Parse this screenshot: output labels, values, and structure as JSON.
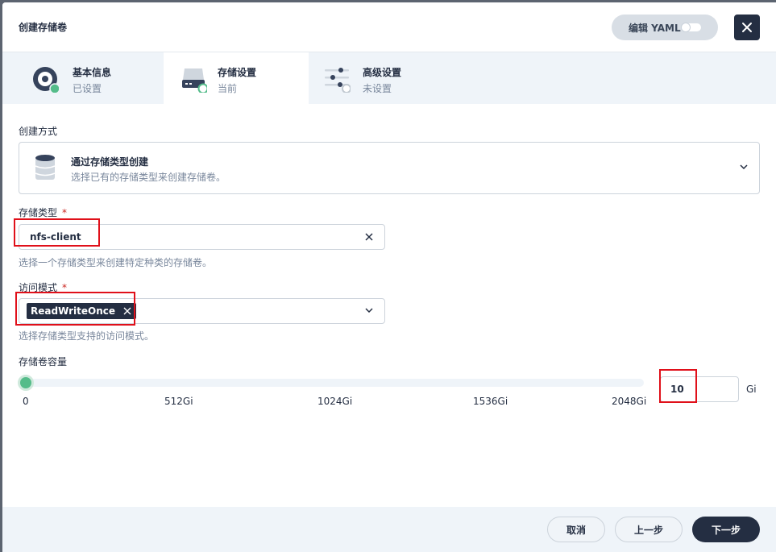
{
  "header": {
    "title": "创建存储卷",
    "yaml_label": "编辑 YAML",
    "yaml_toggle_on": false
  },
  "steps": [
    {
      "name": "基本信息",
      "status": "已设置",
      "icon": "disc-check-icon"
    },
    {
      "name": "存储设置",
      "status": "当前",
      "icon": "hard-drive-icon"
    },
    {
      "name": "高级设置",
      "status": "未设置",
      "icon": "sliders-icon"
    }
  ],
  "method": {
    "label": "创建方式",
    "title": "通过存储类型创建",
    "desc": "选择已有的存储类型来创建存储卷。"
  },
  "storage_class": {
    "label": "存储类型",
    "required": "*",
    "value": "nfs-client",
    "hint": "选择一个存储类型来创建特定种类的存储卷。"
  },
  "access_mode": {
    "label": "访问模式",
    "required": "*",
    "tag": "ReadWriteOnce",
    "hint": "选择存储类型支持的访问模式。"
  },
  "capacity": {
    "label": "存储卷容量",
    "ticks": [
      "0",
      "512Gi",
      "1024Gi",
      "1536Gi",
      "2048Gi"
    ],
    "value": "10",
    "unit": "Gi"
  },
  "footer": {
    "cancel": "取消",
    "prev": "上一步",
    "next": "下一步"
  },
  "colors": {
    "accent_green": "#55bc8a",
    "dark": "#242e42",
    "highlight_red": "#e0101a"
  }
}
